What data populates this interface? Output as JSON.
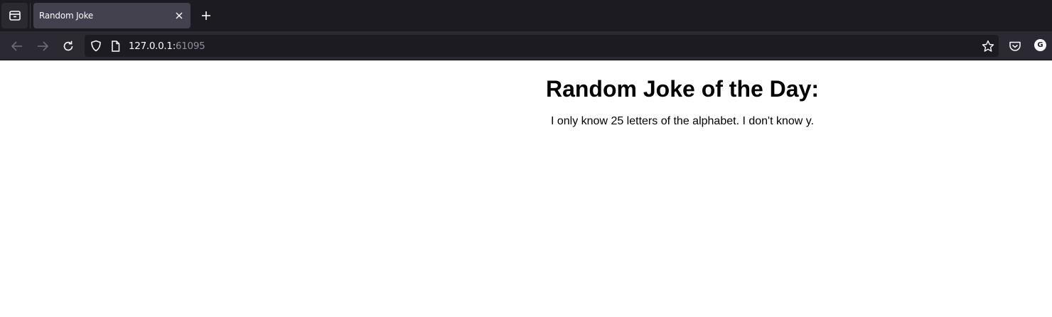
{
  "browser": {
    "tab": {
      "title": "Random Joke"
    },
    "url": {
      "host": "127.0.0.1:",
      "port": "61095"
    },
    "profile_initial": "G",
    "icons": {
      "view": "tab-overview-icon",
      "close": "close-icon",
      "new_tab": "plus-icon",
      "back": "arrow-left-icon",
      "forward": "arrow-right-icon",
      "reload": "reload-icon",
      "shield": "shield-icon",
      "page": "page-icon",
      "bookmark": "star-icon",
      "pocket": "pocket-icon"
    }
  },
  "page": {
    "heading": "Random Joke of the Day:",
    "joke": "I only know 25 letters of the alphabet. I don't know y."
  }
}
